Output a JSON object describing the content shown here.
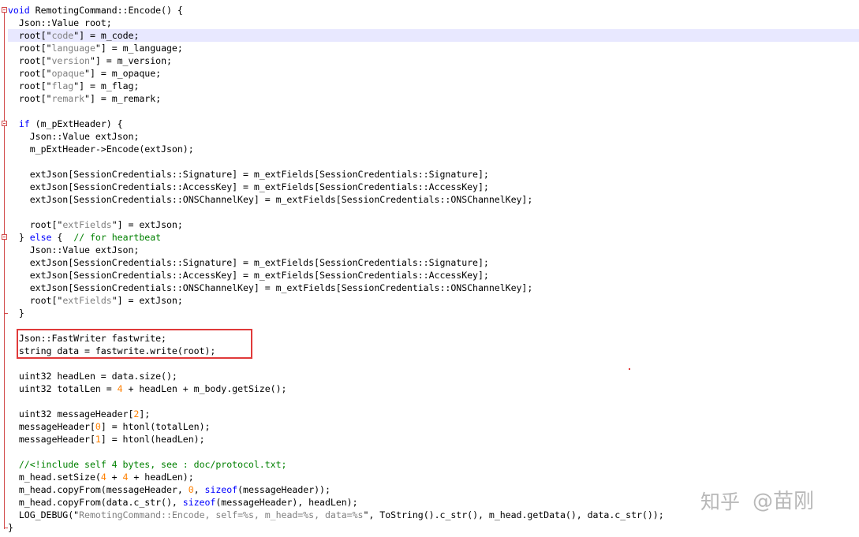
{
  "code": {
    "lines": [
      "void RemotingCommand::Encode() {",
      "  Json::Value root;",
      "  root[\"code\"] = m_code;",
      "  root[\"language\"] = m_language;",
      "  root[\"version\"] = m_version;",
      "  root[\"opaque\"] = m_opaque;",
      "  root[\"flag\"] = m_flag;",
      "  root[\"remark\"] = m_remark;",
      "",
      "  if (m_pExtHeader) {",
      "    Json::Value extJson;",
      "    m_pExtHeader->Encode(extJson);",
      "",
      "    extJson[SessionCredentials::Signature] = m_extFields[SessionCredentials::Signature];",
      "    extJson[SessionCredentials::AccessKey] = m_extFields[SessionCredentials::AccessKey];",
      "    extJson[SessionCredentials::ONSChannelKey] = m_extFields[SessionCredentials::ONSChannelKey];",
      "",
      "    root[\"extFields\"] = extJson;",
      "  } else {  // for heartbeat",
      "    Json::Value extJson;",
      "    extJson[SessionCredentials::Signature] = m_extFields[SessionCredentials::Signature];",
      "    extJson[SessionCredentials::AccessKey] = m_extFields[SessionCredentials::AccessKey];",
      "    extJson[SessionCredentials::ONSChannelKey] = m_extFields[SessionCredentials::ONSChannelKey];",
      "    root[\"extFields\"] = extJson;",
      "  }",
      "",
      "  Json::FastWriter fastwrite;",
      "  string data = fastwrite.write(root);",
      "",
      "  uint32 headLen = data.size();",
      "  uint32 totalLen = 4 + headLen + m_body.getSize();",
      "",
      "  uint32 messageHeader[2];",
      "  messageHeader[0] = htonl(totalLen);",
      "  messageHeader[1] = htonl(headLen);",
      "",
      "  //<!include self 4 bytes, see : doc/protocol.txt;",
      "  m_head.setSize(4 + 4 + headLen);",
      "  m_head.copyFrom(messageHeader, 0, sizeof(messageHeader));",
      "  m_head.copyFrom(data.c_str(), sizeof(messageHeader), headLen);",
      "  LOG_DEBUG(\"RemotingCommand::Encode, self=%s, m_head=%s, data=%s\", ToString().c_str(), m_head.getData(), data.c_str());",
      "}"
    ],
    "current_line": 2
  },
  "colors": {
    "keyword": "#0000ff",
    "string_key": "#808080",
    "number": "#ff8000",
    "comment": "#008000",
    "current_line_bg": "#e8e8ff",
    "fold_marker": "#d24a4a",
    "highlight_box": "#e03a3a"
  },
  "watermark": {
    "text": "知乎 @苗刚",
    "logo_text": "知乎",
    "handle": "@苗刚"
  }
}
